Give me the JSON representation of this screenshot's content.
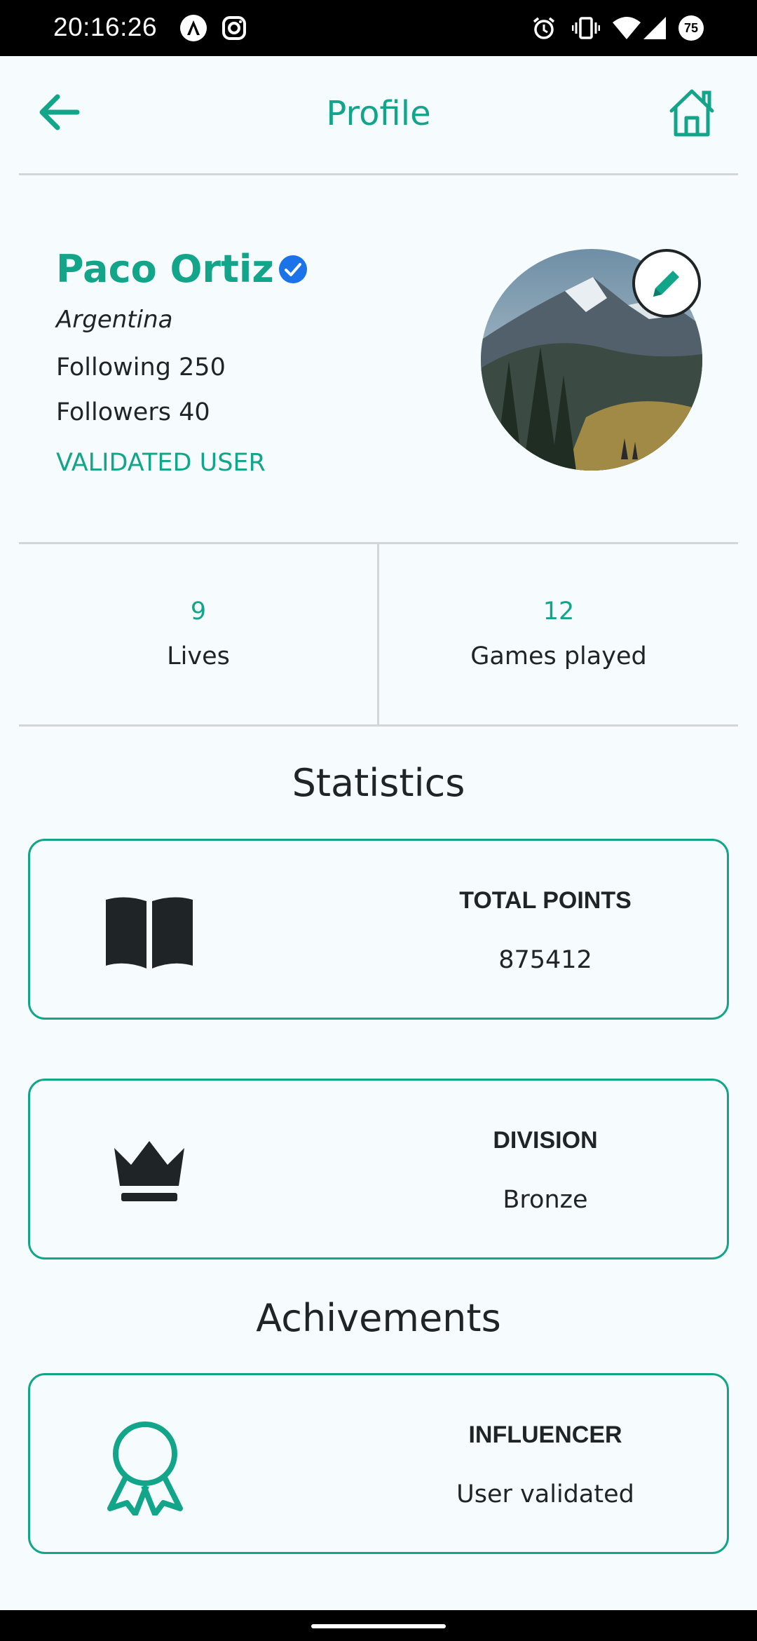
{
  "status_bar": {
    "time": "20:16:26",
    "battery": "75",
    "icons": [
      "app-a-icon",
      "instagram-icon",
      "alarm-icon",
      "vibrate-icon",
      "wifi-icon",
      "signal-icon",
      "battery-icon"
    ]
  },
  "header": {
    "title": "Profile",
    "back_icon": "arrow-left-icon",
    "home_icon": "home-icon"
  },
  "profile": {
    "name": "Paco Ortiz",
    "country": "Argentina",
    "following": "Following 250",
    "followers": "Followers 40",
    "status": "VALIDATED USER"
  },
  "counts": [
    {
      "value": "9",
      "label": "Lives"
    },
    {
      "value": "12",
      "label": "Games played"
    }
  ],
  "statistics": {
    "title": "Statistics",
    "cards": [
      {
        "title": "TOTAL POINTS",
        "value": "875412",
        "icon": "book-icon"
      },
      {
        "title": "DIVISION",
        "value": "Bronze",
        "icon": "crown-icon"
      }
    ]
  },
  "achievements": {
    "title": "Achivements",
    "cards": [
      {
        "title": "INFLUENCER",
        "value": "User validated",
        "icon": "award-ribbon-icon"
      }
    ]
  },
  "colors": {
    "accent": "#12a58a",
    "text": "#1f2426",
    "background": "#f6fbfd",
    "divider": "#d2d6d8",
    "verified": "#1a73e8"
  }
}
